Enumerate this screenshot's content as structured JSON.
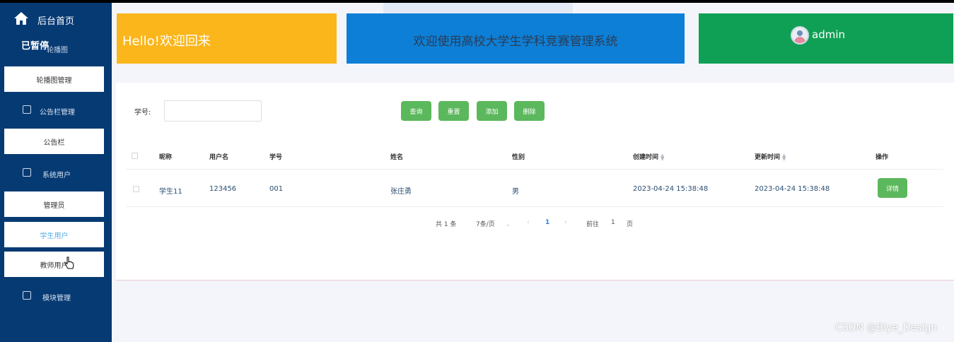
{
  "sidebar": {
    "home_label": "后台首页",
    "paused_label": "已暂停",
    "carousel_group": "轮播图",
    "items": [
      {
        "type": "item",
        "label": "轮播图管理"
      },
      {
        "type": "group",
        "label": "公告栏管理",
        "icon": "edit-icon"
      },
      {
        "type": "item",
        "label": "公告栏"
      },
      {
        "type": "group",
        "label": "系统用户",
        "icon": "user-card-icon"
      },
      {
        "type": "item",
        "label": "管理员"
      },
      {
        "type": "item",
        "label": "学生用户",
        "active": true
      },
      {
        "type": "item",
        "label": "教师用户"
      },
      {
        "type": "group",
        "label": "模块管理",
        "icon": "chart-icon"
      }
    ]
  },
  "banners": {
    "hello": "Hello!欢迎回来",
    "welcome": "欢迎使用高校大学生学科竞赛管理系统",
    "username": "admin"
  },
  "search": {
    "label": "学号:",
    "value": "",
    "placeholder": ""
  },
  "toolbar": {
    "query": "查询",
    "reset": "重置",
    "add": "添加",
    "delete": "删除"
  },
  "table": {
    "headers": [
      "昵称",
      "用户名",
      "学号",
      "姓名",
      "性别",
      "创建时间",
      "更新时间",
      "操作"
    ],
    "rows": [
      {
        "nickname": "学生11",
        "username": "123456",
        "student_id": "001",
        "name": "张庄勇",
        "gender": "男",
        "created": "2023-04-24 15:38:48",
        "updated": "2023-04-24 15:38:48",
        "action": "详情"
      }
    ]
  },
  "pagination": {
    "total": "共 1 条",
    "page_size": "7条/页",
    "current": "1",
    "goto_prefix": "前往",
    "goto_value": "1",
    "goto_suffix": "页"
  },
  "watermark": "CSDN @Biye_Design",
  "colors": {
    "sidebar": "#063a73",
    "yellow": "#fbb61b",
    "blue": "#0d7fd6",
    "green": "#10a055",
    "button": "#5cb85c"
  }
}
